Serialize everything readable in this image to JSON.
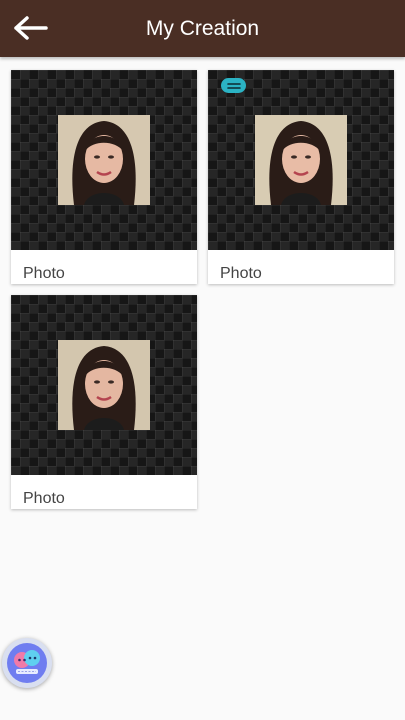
{
  "header": {
    "title": "My Creation",
    "back_icon": "arrow-left-icon"
  },
  "creations": [
    {
      "label": "Photo",
      "has_badge": false
    },
    {
      "label": "Photo",
      "has_badge": true
    },
    {
      "label": "Photo",
      "has_badge": false
    }
  ],
  "fab": {
    "icon": "chat-bubbles-icon"
  },
  "colors": {
    "appbar": "#4a2e24",
    "background": "#fafafa",
    "badge": "#2bb3c4",
    "fab": "#6f7df0"
  }
}
